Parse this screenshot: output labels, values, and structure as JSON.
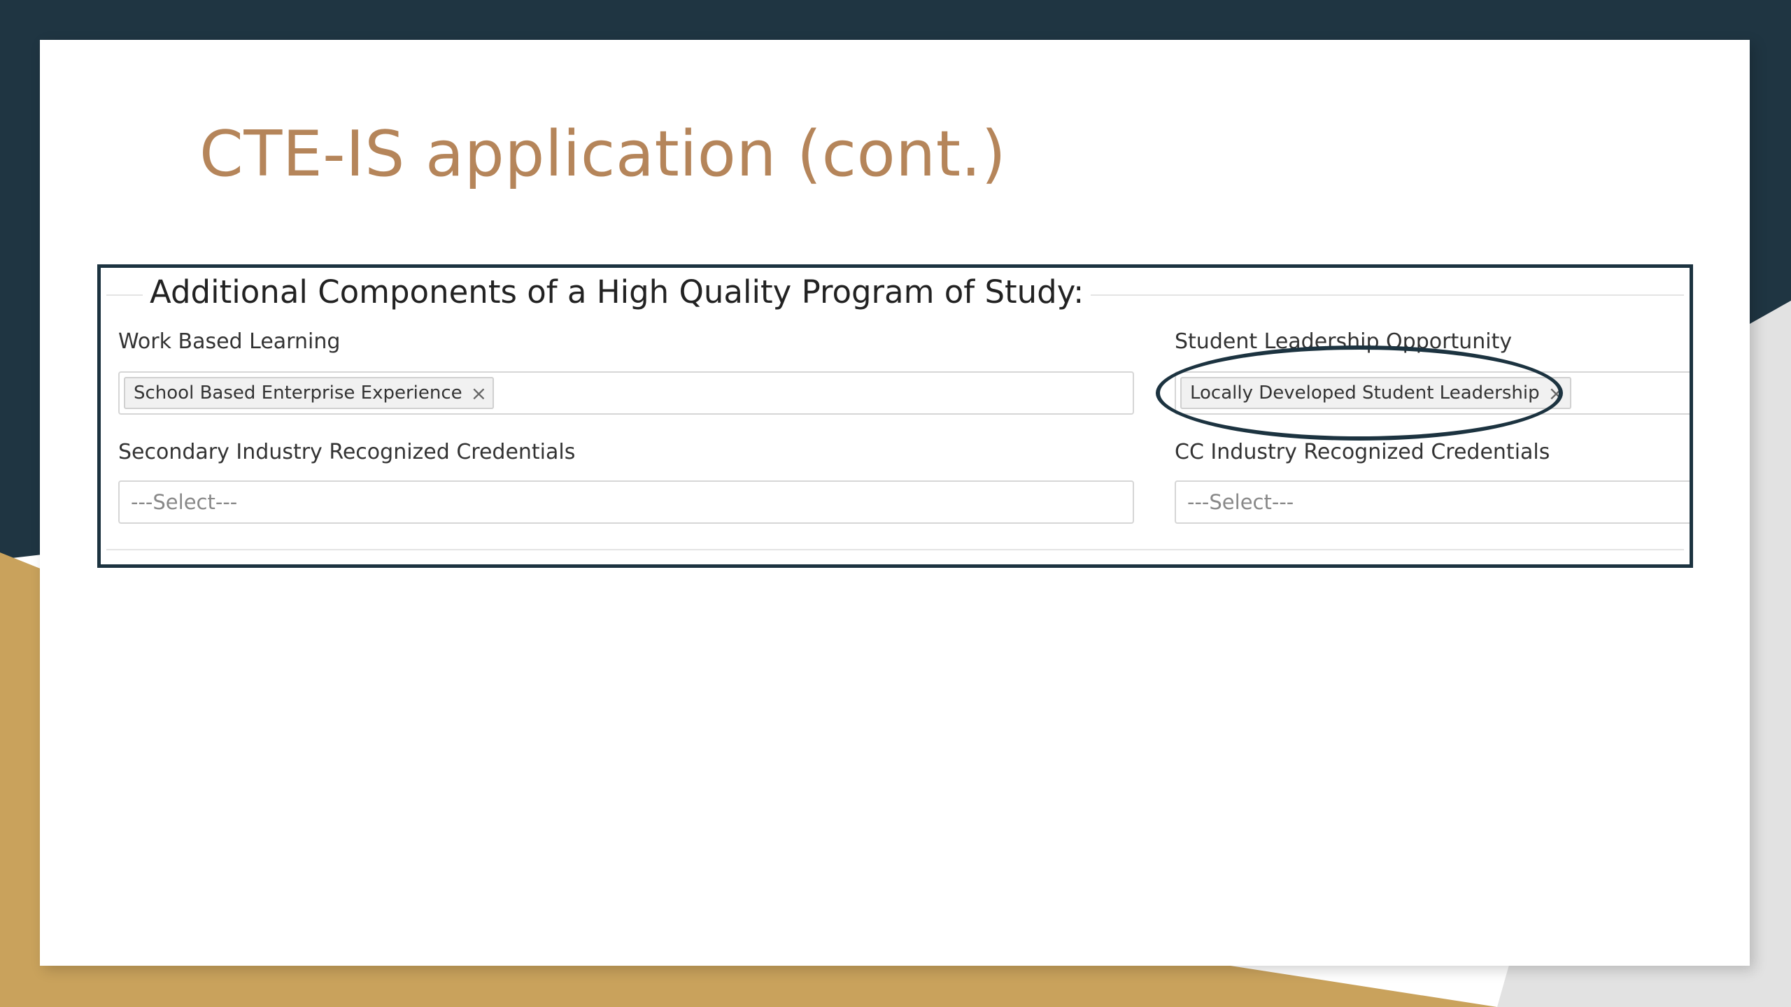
{
  "slide": {
    "title": "CTE-IS application (cont.)",
    "colors": {
      "navy": "#1f3542",
      "gold": "#c9a25c",
      "title": "#b5855a"
    }
  },
  "form": {
    "legend": "Additional Components of a High Quality Program of Study:",
    "work_based_learning": {
      "label": "Work Based Learning",
      "selected": [
        "School Based Enterprise Experience"
      ],
      "remove_glyph": "×"
    },
    "student_leadership": {
      "label": "Student Leadership Opportunity",
      "selected": [
        "Locally Developed Student Leadership"
      ],
      "remove_glyph": "×"
    },
    "secondary_credentials": {
      "label": "Secondary Industry Recognized Credentials",
      "placeholder": "---Select---"
    },
    "cc_credentials": {
      "label": "CC Industry Recognized Credentials",
      "placeholder": "---Select---"
    }
  }
}
